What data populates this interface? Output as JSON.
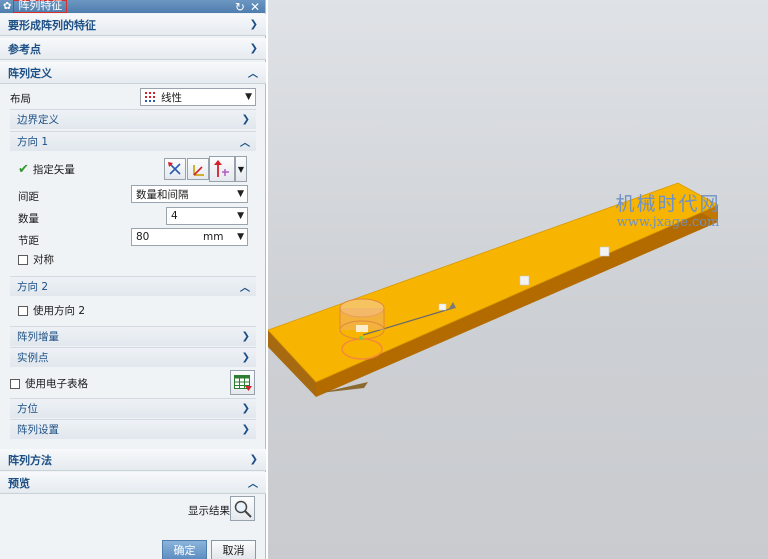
{
  "dialog": {
    "title": "阵列特征",
    "reset_glyph": "↻",
    "close_glyph": "✕",
    "sections": {
      "features": "要形成阵列的特征",
      "reference": "参考点",
      "definition": "阵列定义",
      "method": "阵列方法",
      "preview": "预览"
    },
    "layout": {
      "label": "布局",
      "value": "线性"
    },
    "boundary": "边界定义",
    "direction1": {
      "title": "方向 1",
      "vector_label": "指定矢量",
      "spacing": {
        "label": "间距",
        "value": "数量和间隔"
      },
      "count": {
        "label": "数量",
        "value": "4"
      },
      "pitch": {
        "label": "节距",
        "value": "80",
        "unit": "mm"
      },
      "symmetric": "对称"
    },
    "direction2": {
      "title": "方向 2",
      "use": "使用方向 2"
    },
    "increment": "阵列增量",
    "instance": "实例点",
    "spreadsheet": "使用电子表格",
    "orientation": "方位",
    "settings": "阵列设置",
    "show_result": "显示结果",
    "ok": "确定",
    "cancel": "取消"
  },
  "watermark": {
    "cn": "机械时代网",
    "en": "www.jxage.com"
  },
  "colors": {
    "accent": "#1c4f85",
    "title_bar": "#5884b2",
    "part_top": "#f7b400",
    "part_side": "#b06800",
    "checkmark": "#2e9a2e"
  }
}
